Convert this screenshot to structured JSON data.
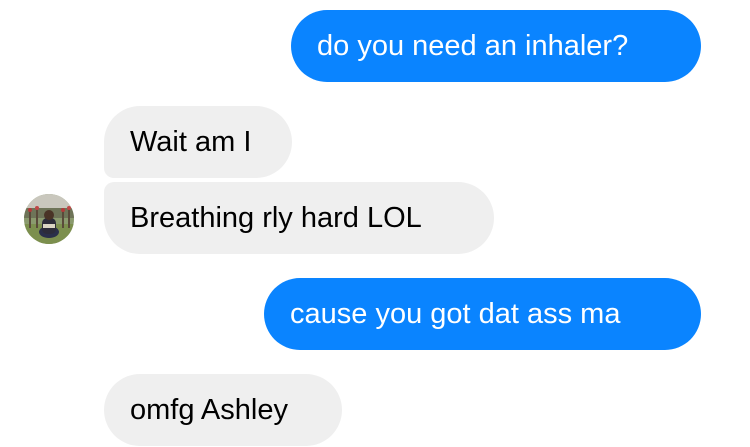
{
  "conversation": {
    "messages": [
      {
        "sender": "self",
        "text": "do you need an inhaler?"
      },
      {
        "sender": "contact",
        "text": "Wait am I"
      },
      {
        "sender": "contact",
        "text": "Breathing rly hard LOL"
      },
      {
        "sender": "self",
        "text": "cause you got dat ass ma"
      },
      {
        "sender": "contact",
        "text": "omfg Ashley"
      }
    ]
  },
  "colors": {
    "sent_bubble": "#0a84ff",
    "received_bubble": "#efefef"
  },
  "icons": {
    "contact_avatar": "contact-avatar-photo"
  }
}
